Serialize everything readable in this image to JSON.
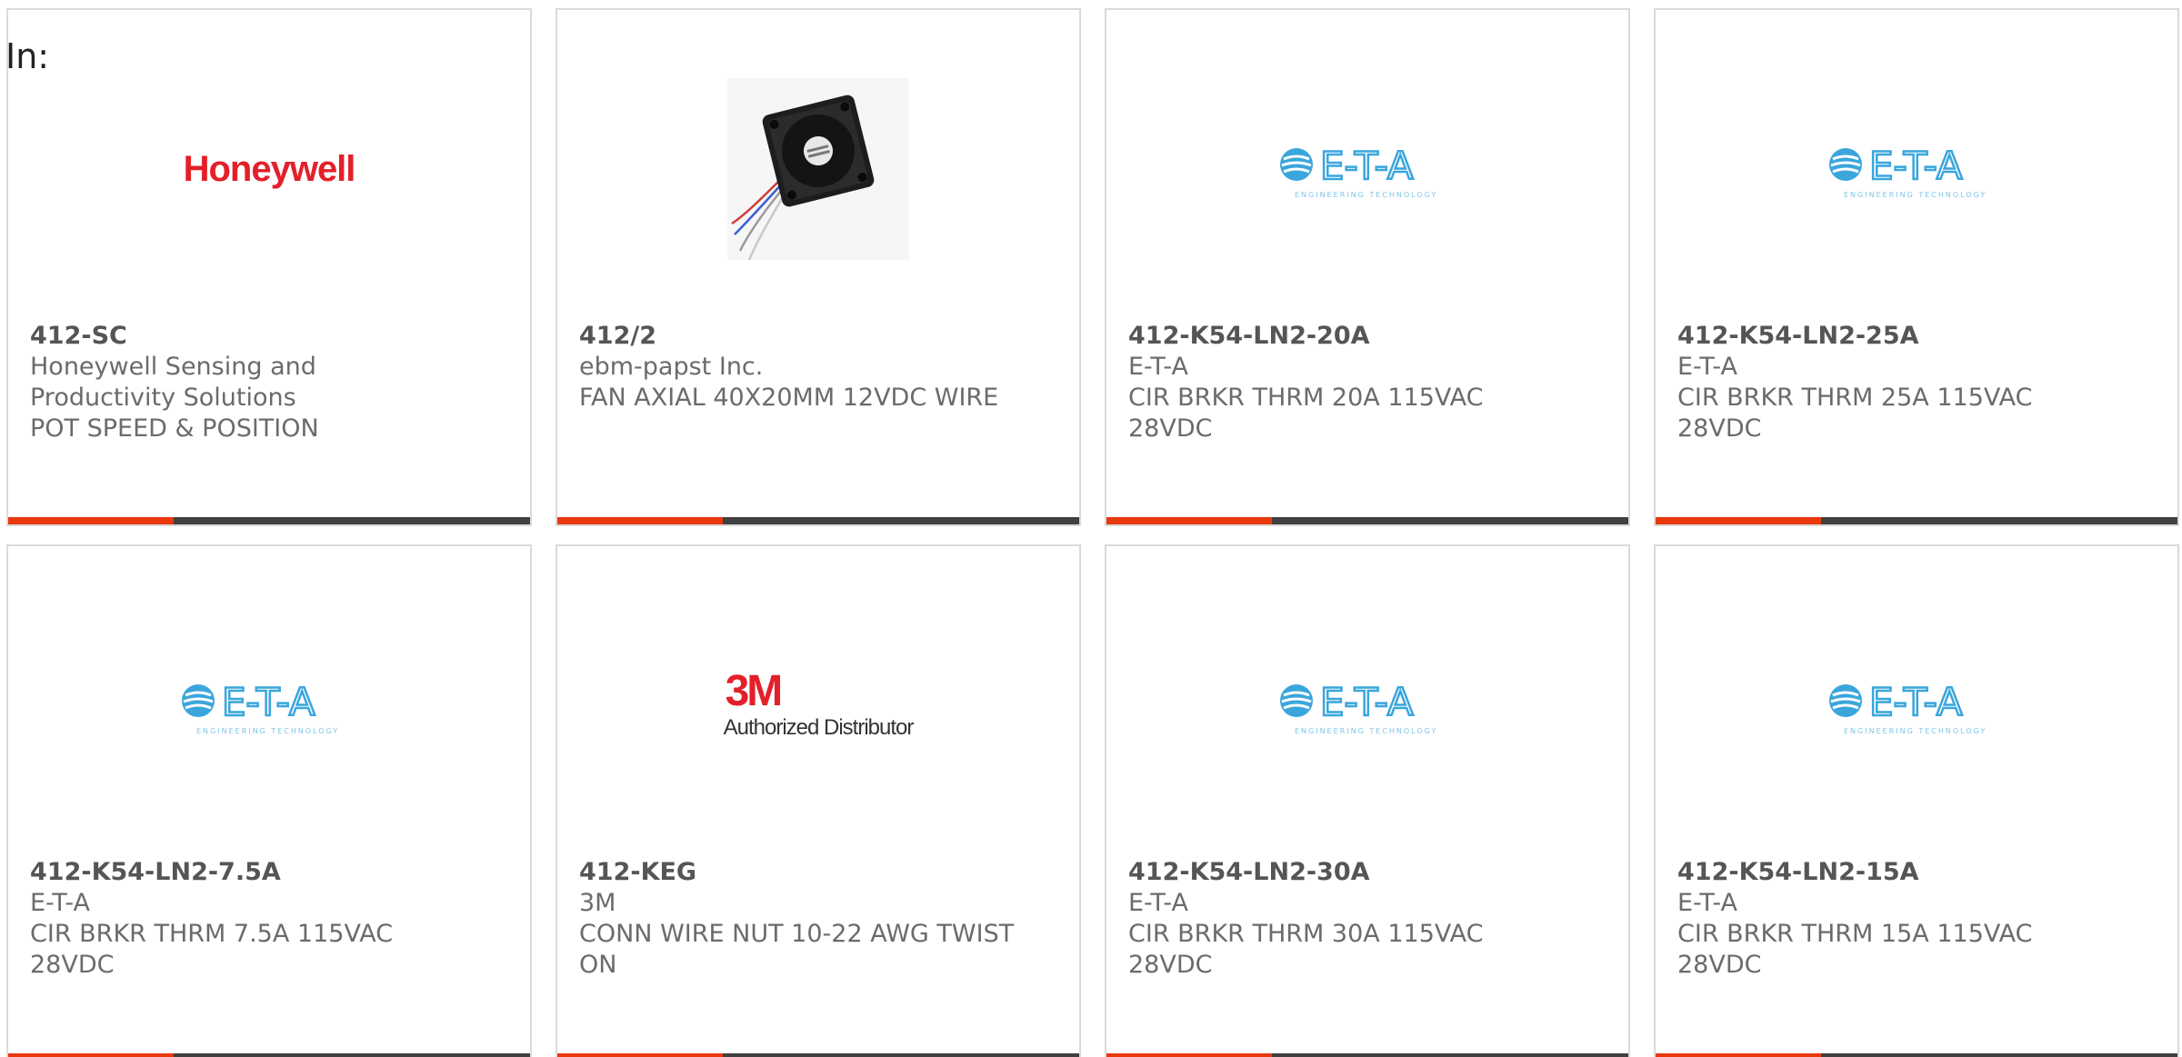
{
  "filter_label": "In:",
  "products": [
    {
      "part_number": "412-SC",
      "manufacturer": "Honeywell Sensing and Productivity Solutions",
      "description": "POT SPEED & POSITION",
      "logo": "honeywell-logo",
      "logo_text": "Honeywell"
    },
    {
      "part_number": "412/2",
      "manufacturer": "ebm-papst Inc.",
      "description": "FAN AXIAL 40X20MM 12VDC WIRE",
      "logo": "fan-product-image"
    },
    {
      "part_number": "412-K54-LN2-20A",
      "manufacturer": "E-T-A",
      "description": "CIR BRKR THRM 20A 115VAC 28VDC",
      "logo": "eta-logo",
      "logo_text": "E-T-A"
    },
    {
      "part_number": "412-K54-LN2-25A",
      "manufacturer": "E-T-A",
      "description": "CIR BRKR THRM 25A 115VAC 28VDC",
      "logo": "eta-logo",
      "logo_text": "E-T-A"
    },
    {
      "part_number": "412-K54-LN2-7.5A",
      "manufacturer": "E-T-A",
      "description": "CIR BRKR THRM 7.5A 115VAC 28VDC",
      "logo": "eta-logo",
      "logo_text": "E-T-A"
    },
    {
      "part_number": "412-KEG",
      "manufacturer": "3M",
      "description": "CONN WIRE NUT 10-22 AWG TWIST ON",
      "logo": "3m-logo",
      "logo_text": "3M",
      "logo_subtext": "Authorized Distributor"
    },
    {
      "part_number": "412-K54-LN2-30A",
      "manufacturer": "E-T-A",
      "description": "CIR BRKR THRM 30A 115VAC 28VDC",
      "logo": "eta-logo",
      "logo_text": "E-T-A"
    },
    {
      "part_number": "412-K54-LN2-15A",
      "manufacturer": "E-T-A",
      "description": "CIR BRKR THRM 15A 115VAC 28VDC",
      "logo": "eta-logo",
      "logo_text": "E-T-A"
    }
  ],
  "colors": {
    "accent": "#e8380d",
    "bar": "#404040",
    "eta_blue": "#3aa6dc",
    "brand_red": "#e3202a"
  }
}
